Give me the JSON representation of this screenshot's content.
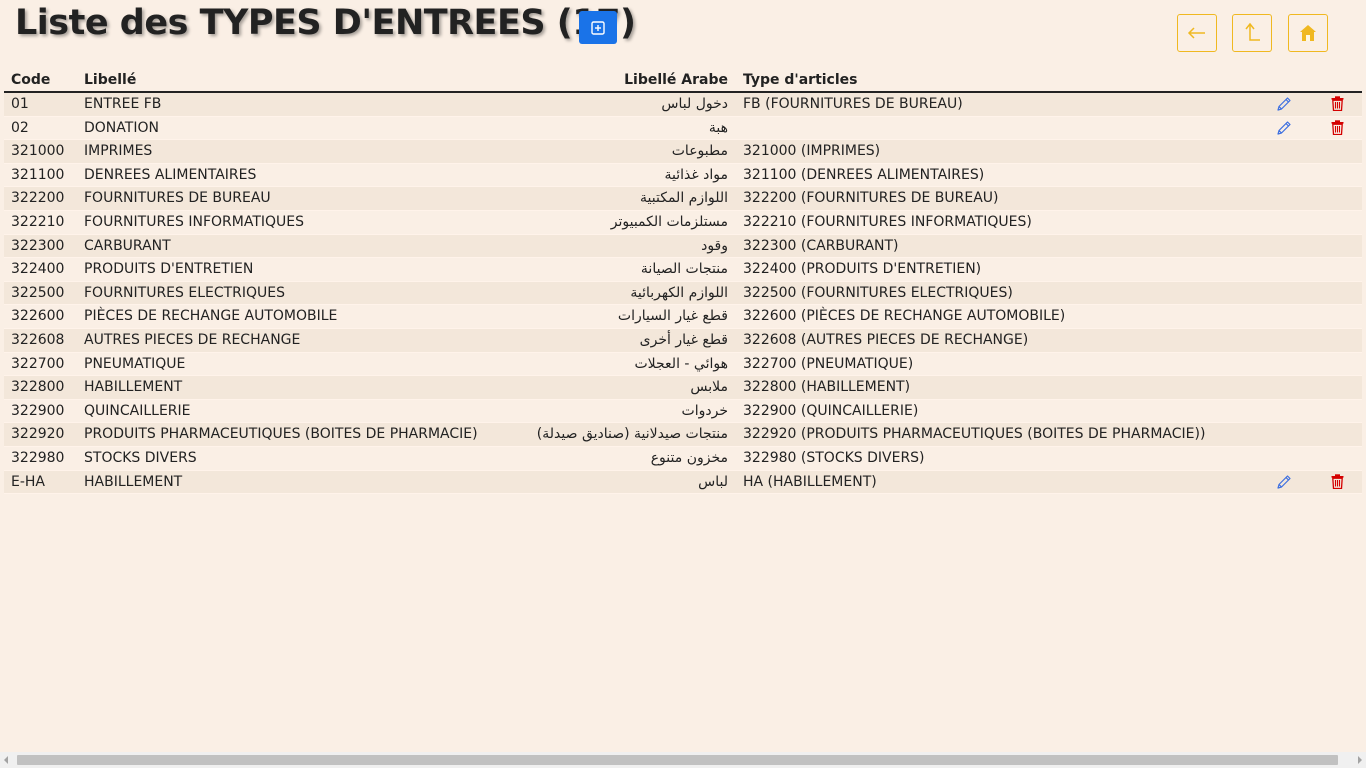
{
  "page": {
    "title": "Liste des TYPES D'ENTREES (17)"
  },
  "colors": {
    "add_button": "#1a73e8",
    "nav_border": "#f0b820",
    "edit_icon": "#3d6fe0",
    "delete_icon": "#d40000",
    "background": "#faefe5",
    "row_stripe": "#f3e7da"
  },
  "toolbar": {
    "add_icon": "plus-square-icon",
    "nav": [
      {
        "name": "back",
        "icon": "arrow-left-icon"
      },
      {
        "name": "up",
        "icon": "arrow-up-icon"
      },
      {
        "name": "home",
        "icon": "home-icon"
      }
    ]
  },
  "table": {
    "headers": {
      "code": "Code",
      "libelle": "Libellé",
      "libelle_arabe": "Libellé Arabe",
      "type": "Type d'articles"
    },
    "rows": [
      {
        "code": "01",
        "libelle": "ENTREE FB",
        "arabe": "دخول لباس",
        "type": "FB (FOURNITURES DE BUREAU)",
        "actions": true
      },
      {
        "code": "02",
        "libelle": "DONATION",
        "arabe": "هبة",
        "type": "",
        "actions": true
      },
      {
        "code": "321000",
        "libelle": "IMPRIMES",
        "arabe": "مطبوعات",
        "type": "321000 (IMPRIMES)",
        "actions": false
      },
      {
        "code": "321100",
        "libelle": "DENREES ALIMENTAIRES",
        "arabe": "مواد غذائية",
        "type": "321100 (DENREES ALIMENTAIRES)",
        "actions": false
      },
      {
        "code": "322200",
        "libelle": "FOURNITURES DE BUREAU",
        "arabe": "اللوازم المكتبية",
        "type": "322200 (FOURNITURES DE BUREAU)",
        "actions": false
      },
      {
        "code": "322210",
        "libelle": "FOURNITURES INFORMATIQUES",
        "arabe": "مستلزمات الكمبيوتر",
        "type": "322210 (FOURNITURES INFORMATIQUES)",
        "actions": false
      },
      {
        "code": "322300",
        "libelle": "CARBURANT",
        "arabe": "وقود",
        "type": "322300 (CARBURANT)",
        "actions": false
      },
      {
        "code": "322400",
        "libelle": "PRODUITS D'ENTRETIEN",
        "arabe": "منتجات الصيانة",
        "type": "322400 (PRODUITS D'ENTRETIEN)",
        "actions": false
      },
      {
        "code": "322500",
        "libelle": "FOURNITURES ELECTRIQUES",
        "arabe": "اللوازم الكهربائية",
        "type": "322500 (FOURNITURES ELECTRIQUES)",
        "actions": false
      },
      {
        "code": "322600",
        "libelle": "PIÈCES DE RECHANGE AUTOMOBILE",
        "arabe": "قطع غيار السيارات",
        "type": "322600 (PIÈCES DE RECHANGE AUTOMOBILE)",
        "actions": false
      },
      {
        "code": "322608",
        "libelle": "AUTRES PIECES DE RECHANGE",
        "arabe": "قطع غيار أخرى",
        "type": "322608 (AUTRES PIECES DE RECHANGE)",
        "actions": false
      },
      {
        "code": "322700",
        "libelle": "PNEUMATIQUE",
        "arabe": "هوائي - العجلات",
        "type": "322700 (PNEUMATIQUE)",
        "actions": false
      },
      {
        "code": "322800",
        "libelle": "HABILLEMENT",
        "arabe": "ملابس",
        "type": "322800 (HABILLEMENT)",
        "actions": false
      },
      {
        "code": "322900",
        "libelle": "QUINCAILLERIE",
        "arabe": "خردوات",
        "type": "322900 (QUINCAILLERIE)",
        "actions": false
      },
      {
        "code": "322920",
        "libelle": "PRODUITS PHARMACEUTIQUES (BOITES DE PHARMACIE)",
        "arabe": "منتجات صيدلانية (صناديق صيدلة)",
        "type": "322920 (PRODUITS PHARMACEUTIQUES (BOITES DE PHARMACIE))",
        "actions": false
      },
      {
        "code": "322980",
        "libelle": "STOCKS DIVERS",
        "arabe": "مخزون متنوع",
        "type": "322980 (STOCKS DIVERS)",
        "actions": false
      },
      {
        "code": "E-HA",
        "libelle": "HABILLEMENT",
        "arabe": "لباس",
        "type": "HA (HABILLEMENT)",
        "actions": true
      }
    ]
  }
}
